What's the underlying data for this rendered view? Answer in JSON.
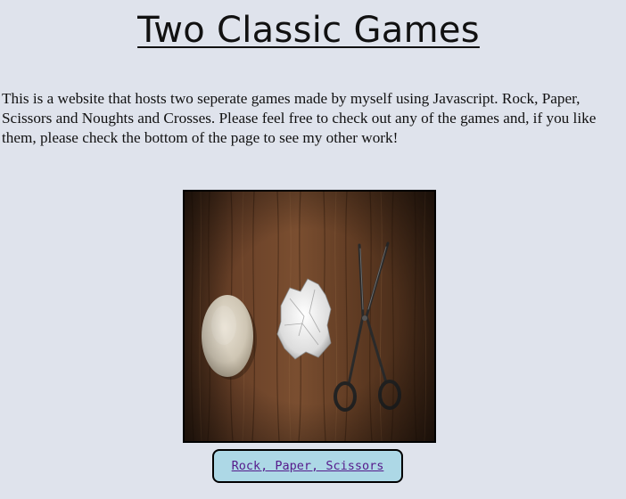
{
  "page": {
    "title": "Two Classic Games",
    "intro": "This is a website that hosts two seperate games made by myself using Javascript. Rock, Paper, Scissors and Noughts and Crosses. Please feel free to check out any of the games and, if you like them, please check the bottom of the page to see my other work!"
  },
  "games": [
    {
      "image_icon": "rock-paper-scissors-photo",
      "link_label": "Rock, Paper, Scissors"
    }
  ],
  "colors": {
    "background": "#dfe3ec",
    "button_background": "#add8e6",
    "link": "#551a8b"
  }
}
